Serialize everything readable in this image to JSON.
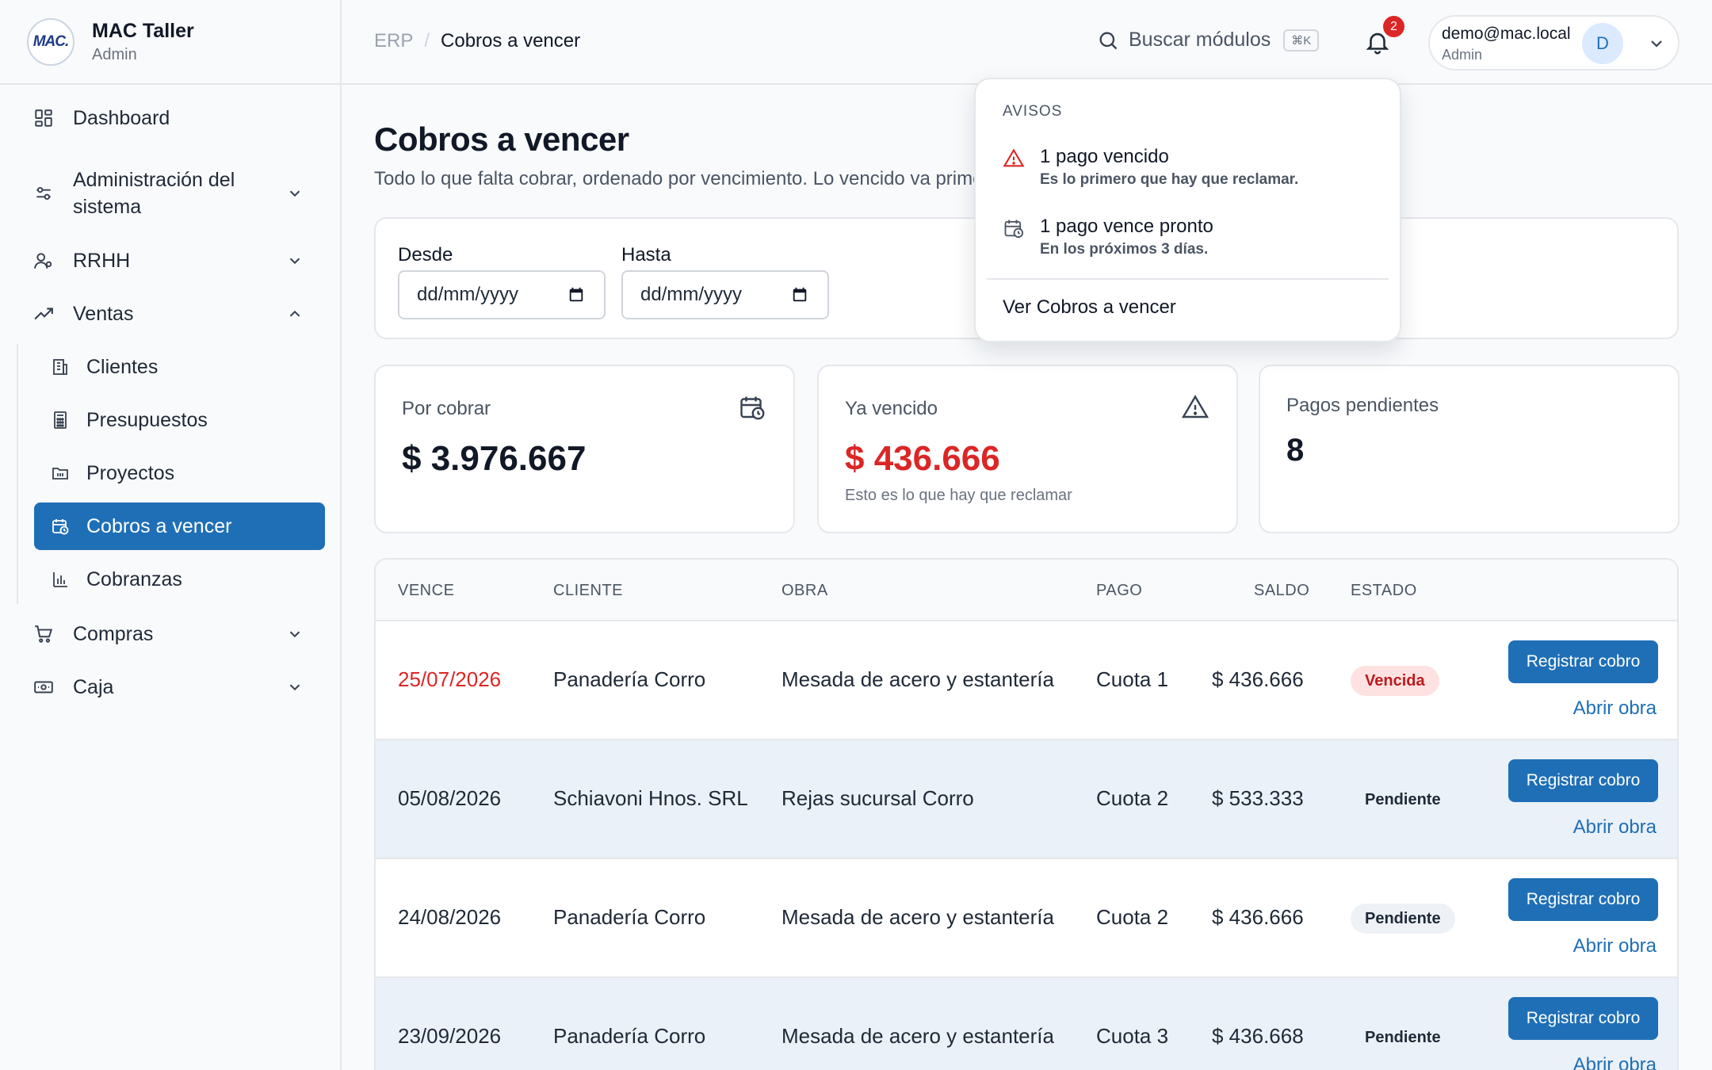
{
  "brand": {
    "logo_text": "MAC.",
    "name": "MAC Taller",
    "role": "Admin"
  },
  "sidebar": {
    "items": [
      {
        "label": "Dashboard",
        "icon": "dashboard-icon"
      },
      {
        "label": "Administración del sistema",
        "icon": "sliders-icon",
        "expandable": true
      },
      {
        "label": "RRHH",
        "icon": "users-icon",
        "expandable": true
      },
      {
        "label": "Ventas",
        "icon": "trending-up-icon",
        "expanded": true
      },
      {
        "label": "Compras",
        "icon": "cart-icon",
        "expandable": true
      },
      {
        "label": "Caja",
        "icon": "cash-icon",
        "expandable": true
      }
    ],
    "admin_line1": "Administración del",
    "admin_line2": "sistema",
    "ventas_sub": [
      {
        "label": "Clientes",
        "icon": "building-icon"
      },
      {
        "label": "Presupuestos",
        "icon": "calculator-icon"
      },
      {
        "label": "Proyectos",
        "icon": "folder-icon"
      },
      {
        "label": "Cobros a vencer",
        "icon": "calendar-clock-icon",
        "active": true
      },
      {
        "label": "Cobranzas",
        "icon": "bar-chart-icon"
      }
    ]
  },
  "header": {
    "breadcrumb_root": "ERP",
    "breadcrumb_sep": "/",
    "breadcrumb_current": "Cobros a vencer",
    "search_placeholder": "Buscar módulos",
    "search_shortcut": "⌘K",
    "notifications_count": "2",
    "user_email": "demo@mac.local",
    "user_role": "Admin",
    "avatar_initial": "D"
  },
  "page": {
    "title": "Cobros a vencer",
    "subtitle": "Todo lo que falta cobrar, ordenado por vencimiento. Lo vencido va primero y en"
  },
  "filters": {
    "from_label": "Desde",
    "to_label": "Hasta",
    "from_value": "dd/mm/yyyy",
    "to_value": "dd/mm/yyyy"
  },
  "cards": {
    "por_cobrar_label": "Por cobrar",
    "por_cobrar_value": "$ 3.976.667",
    "vencido_label": "Ya vencido",
    "vencido_value": "$ 436.666",
    "vencido_note": "Esto es lo que hay que reclamar",
    "pendientes_label": "Pagos pendientes",
    "pendientes_value": "8"
  },
  "table": {
    "headers": [
      "VENCE",
      "CLIENTE",
      "OBRA",
      "PAGO",
      "SALDO",
      "ESTADO"
    ],
    "register_label": "Registrar cobro",
    "open_label": "Abrir obra",
    "rows": [
      {
        "vence": "25/07/2026",
        "cliente": "Panadería Corro",
        "obra": "Mesada de acero y estantería",
        "pago": "Cuota 1",
        "saldo": "$ 436.666",
        "estado": "Vencida"
      },
      {
        "vence": "05/08/2026",
        "cliente": "Schiavoni Hnos. SRL",
        "obra": "Rejas sucursal Corro",
        "pago": "Cuota 2",
        "saldo": "$ 533.333",
        "estado": "Pendiente"
      },
      {
        "vence": "24/08/2026",
        "cliente": "Panadería Corro",
        "obra": "Mesada de acero y estantería",
        "pago": "Cuota 2",
        "saldo": "$ 436.666",
        "estado": "Pendiente"
      },
      {
        "vence": "23/09/2026",
        "cliente": "Panadería Corro",
        "obra": "Mesada de acero y estantería",
        "pago": "Cuota 3",
        "saldo": "$ 436.668",
        "estado": "Pendiente"
      }
    ]
  },
  "notifications": {
    "heading": "AVISOS",
    "items": [
      {
        "title": "1 pago vencido",
        "desc": "Es lo primero que hay que reclamar.",
        "icon": "alert-triangle-icon"
      },
      {
        "title": "1 pago vence pronto",
        "desc": "En los próximos 3 días.",
        "icon": "calendar-clock-icon"
      }
    ],
    "link": "Ver Cobros a vencer"
  },
  "colors": {
    "accent": "#1f6fb6",
    "danger": "#dc2626",
    "badge": "#dc2626"
  }
}
